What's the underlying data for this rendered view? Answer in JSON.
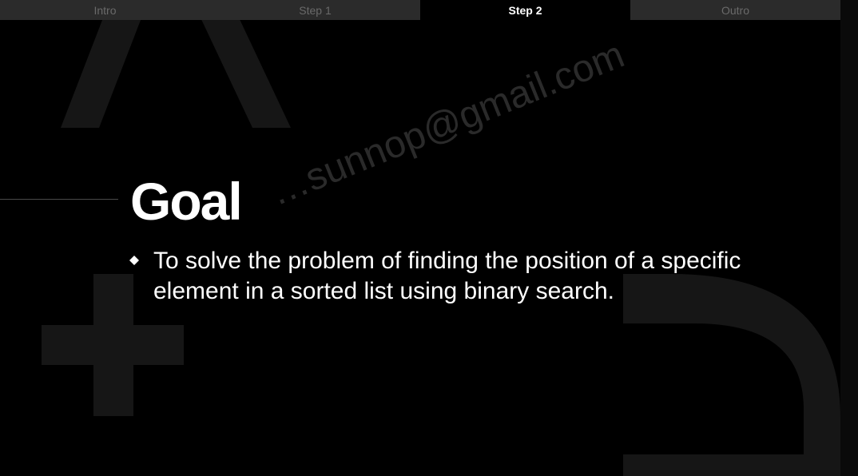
{
  "tabs": [
    {
      "label": "Intro",
      "active": false
    },
    {
      "label": "Step 1",
      "active": false
    },
    {
      "label": "Step 2",
      "active": true
    },
    {
      "label": "Outro",
      "active": false
    }
  ],
  "slide": {
    "title": "Goal",
    "bullets": [
      "To solve the problem of finding the position of a specific element in a sorted list using binary search."
    ],
    "watermark": "…sunnop@gmail.com"
  },
  "colors": {
    "background": "#000000",
    "tab_inactive_bg": "#2b2b2b",
    "tab_inactive_text": "#6a6a6a",
    "tab_active_text": "#ffffff",
    "text": "#ffffff",
    "deco_shapes": "#161616"
  },
  "icons": [
    "diamond-bullet-icon",
    "triangle-shape",
    "plus-shape",
    "d-shape"
  ]
}
